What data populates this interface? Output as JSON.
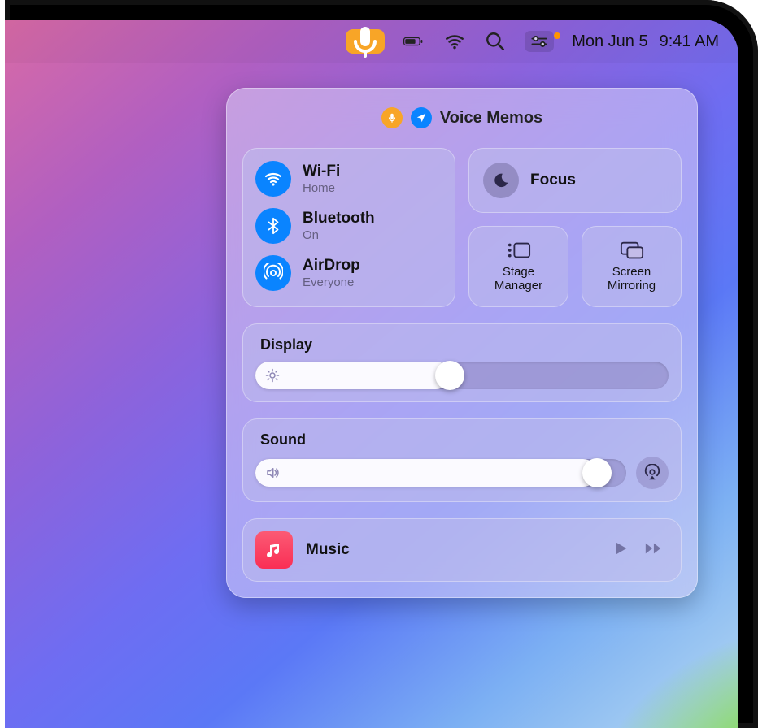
{
  "menubar": {
    "date": "Mon Jun 5",
    "time": "9:41 AM"
  },
  "control_center": {
    "header": {
      "app_badge_label": "Voice Memos"
    },
    "network": {
      "wifi": {
        "title": "Wi-Fi",
        "subtitle": "Home"
      },
      "bluetooth": {
        "title": "Bluetooth",
        "subtitle": "On"
      },
      "airdrop": {
        "title": "AirDrop",
        "subtitle": "Everyone"
      }
    },
    "focus": {
      "label": "Focus"
    },
    "stage": {
      "label": "Stage\nManager"
    },
    "mirroring": {
      "label": "Screen\nMirroring"
    },
    "display": {
      "label": "Display",
      "value_pct": 47
    },
    "sound": {
      "label": "Sound",
      "value_pct": 92
    },
    "now_playing": {
      "app": "Music"
    }
  },
  "colors": {
    "system_blue": "#0a84ff",
    "system_orange": "#f8a527"
  }
}
